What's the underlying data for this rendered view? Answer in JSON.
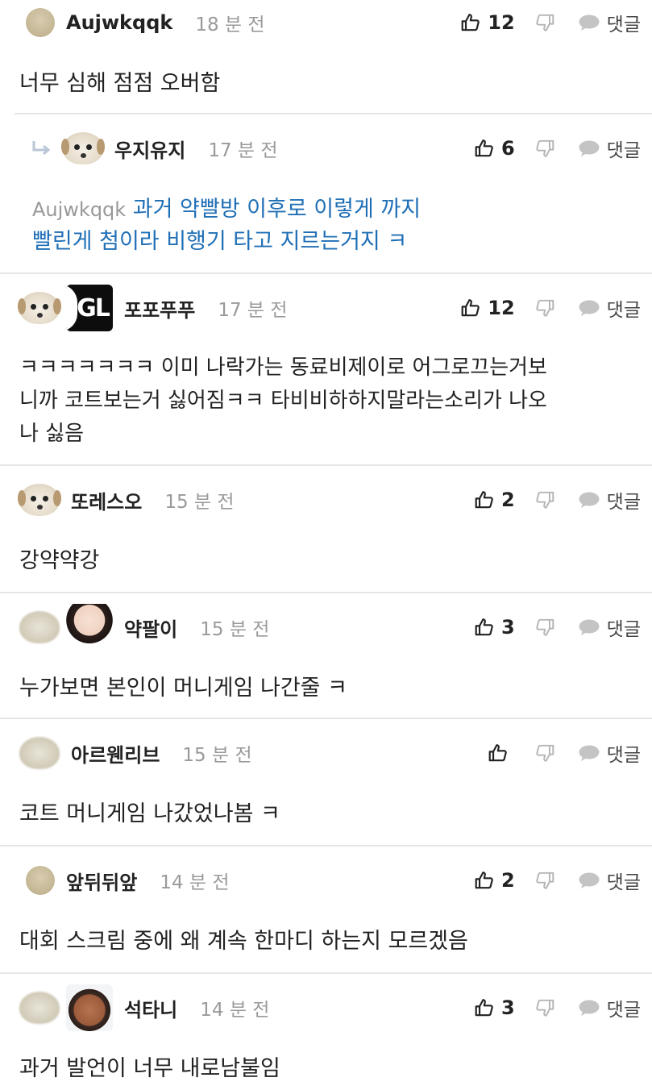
{
  "ui": {
    "reply_label": "댓글"
  },
  "comments": [
    {
      "author": "Aujwkqqk",
      "time": "18 분 전",
      "likes": "12",
      "text": "너무 심해 점점 오버함"
    },
    {
      "author": "우지유지",
      "time": "17 분 전",
      "likes": "6",
      "mention": "Aujwkqqk",
      "text_line1": "과거 약빨방 이후로 이렇게 까지",
      "text_line2": "빨린게 첨이라 비행기 타고 지르는거지 ㅋ"
    },
    {
      "author": "포포푸푸",
      "badge_text": "GL",
      "time": "17 분 전",
      "likes": "12",
      "text_line1": "ㅋㅋㅋㅋㅋㅋㅋ 이미 나락가는 동료비제이로 어그로끄는거보",
      "text_line2": "니까 코트보는거 싫어짐ㅋㅋ 타비비하하지말라는소리가 나오",
      "text_line3": "나 싫음"
    },
    {
      "author": "또레스오",
      "time": "15 분 전",
      "likes": "2",
      "text": "강약약강"
    },
    {
      "author": "약팔이",
      "time": "15 분 전",
      "likes": "3",
      "text": "누가보면 본인이 머니게임 나간줄 ㅋ"
    },
    {
      "author": "아르웬리브",
      "time": "15 분 전",
      "likes": "",
      "text": "코트 머니게임 나갔었나봄 ㅋ"
    },
    {
      "author": "앞뒤뒤앞",
      "time": "14 분 전",
      "likes": "2",
      "text": "대회 스크림 중에 왜 계속 한마디 하는지 모르겠음"
    },
    {
      "author": "석타니",
      "time": "14 분 전",
      "likes": "3",
      "text": "과거 발언이 너무 내로남불임"
    }
  ],
  "colors": {
    "reply_text": "#1f6fb6",
    "time": "#9a9a9a",
    "separator": "#e6e6e6"
  }
}
